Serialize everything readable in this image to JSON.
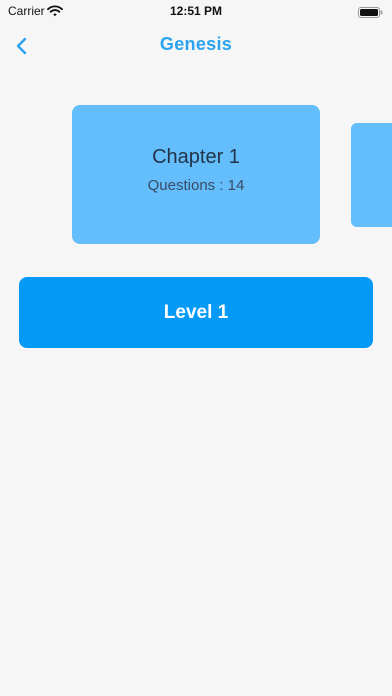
{
  "status_bar": {
    "carrier": "Carrier",
    "time": "12:51 PM",
    "wifi_icon": "wifi-icon",
    "battery_icon": "battery-icon"
  },
  "nav": {
    "title": "Genesis",
    "back_icon": "chevron-left-icon"
  },
  "chapters": [
    {
      "title": "Chapter 1",
      "questions": "Questions : 14"
    }
  ],
  "level_button": {
    "label": "Level 1"
  },
  "colors": {
    "accent": "#2aa3ee",
    "card": "#63befb",
    "button": "#059af7",
    "background": "#f6f6f6"
  }
}
